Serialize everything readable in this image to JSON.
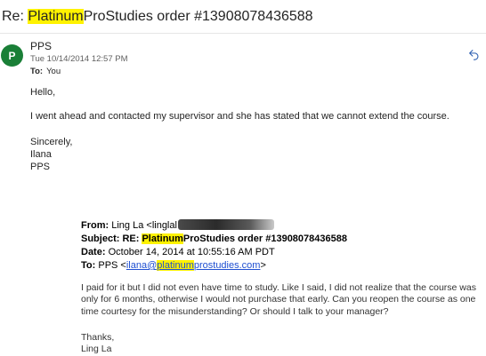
{
  "subject": {
    "prefix": "Re: ",
    "highlight": "Platinum",
    "rest": "ProStudies order #13908078436588"
  },
  "sender": {
    "avatar_letter": "P",
    "avatar_color": "#1a7f37",
    "name": "PPS",
    "date": "Tue 10/14/2014 12:57 PM",
    "to_label": "To:",
    "to_value": "You"
  },
  "icons": {
    "reply": "reply-icon"
  },
  "body": {
    "greeting": "Hello,",
    "message": "I went ahead and contacted my supervisor and she has stated that we cannot extend the course.",
    "sign_off": "Sincerely,",
    "sign_name": "Ilana",
    "sign_org": "PPS"
  },
  "quoted": {
    "from_label": "From:",
    "from_value": "Ling La <",
    "from_email_visible": "linglal",
    "subject_label": "Subject:",
    "subject_prefix": "RE: ",
    "subject_highlight": "Platinum",
    "subject_rest": "ProStudies order #13908078436588",
    "date_label": "Date:",
    "date_value": "October 14, 2014 at 10:55:16 AM PDT",
    "to_label": "To:",
    "to_prefix": "PPS <",
    "to_email_a": "ilana@",
    "to_email_highlight": "platinum",
    "to_email_b": "prostudies.com",
    "to_suffix": ">",
    "body": "I paid for it but I did not even have time to study.  Like I said, I did not realize that the course was only for  6 months, otherwise I would not purchase that early.  Can you reopen the course as one time courtesy for the misunderstanding?  Or should I talk to your manager?",
    "thanks": "Thanks,",
    "name": "Ling La"
  },
  "colors": {
    "highlight": "#fff200",
    "link": "#1f4fd1"
  }
}
